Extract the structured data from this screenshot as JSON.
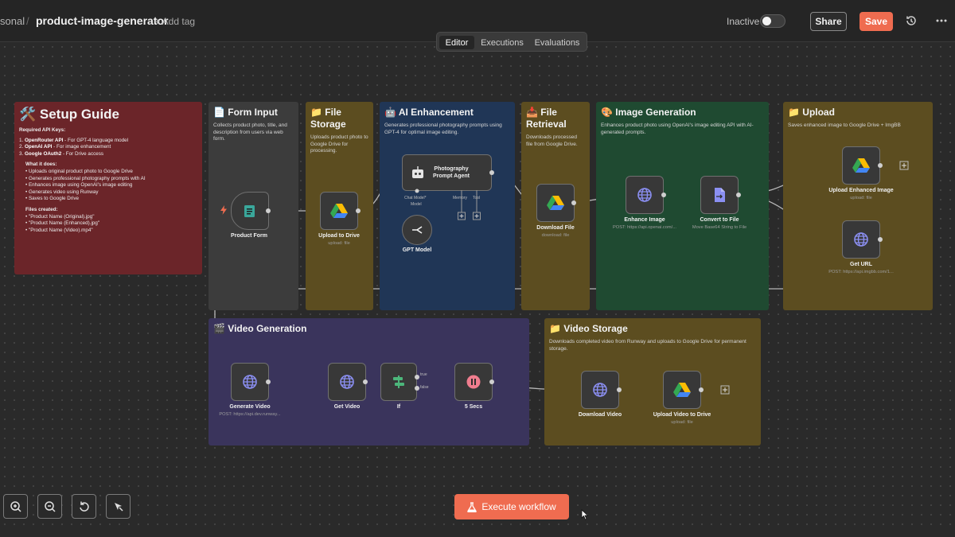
{
  "header": {
    "breadcrumb_personal": "sonal",
    "breadcrumb_sep": "/",
    "workflow_name": "product-image-generator",
    "add_tag": "+ Add tag",
    "status_label": "Inactive",
    "share_label": "Share",
    "save_label": "Save"
  },
  "tabs": [
    "Editor",
    "Executions",
    "Evaluations"
  ],
  "setup_guide": {
    "title": "🛠️ Setup Guide",
    "required_heading": "Required API Keys:",
    "api_keys": [
      {
        "name": "OpenRouter API",
        "desc": " - For GPT-4 language model"
      },
      {
        "name": "OpenAI API",
        "desc": " - For image enhancement"
      },
      {
        "name": "Google OAuth2",
        "desc": " - For Drive access"
      }
    ],
    "what_heading": "What it does:",
    "what_items": [
      "Uploads original product photo to Google Drive",
      "Generates professional photography prompts with AI",
      "Enhances image using OpenAI's image editing",
      "Generates video using Runway",
      "Saves to Google Drive"
    ],
    "files_heading": "Files created:",
    "files_items": [
      "\"Product Name (Original).jpg\"",
      "\"Product Name (Enhanced).jpg\"",
      "\"Product Name (Video).mp4\""
    ]
  },
  "stickies": {
    "form_input": {
      "title": "📄 Form Input",
      "desc": "Collects product photo, title, and description from users via web form."
    },
    "file_storage": {
      "title": "📁 File Storage",
      "desc": "Uploads product photo to Google Drive for processing."
    },
    "ai_enhancement": {
      "title": "🤖 AI Enhancement",
      "desc": "Generates professional photography prompts using GPT-4 for optimal image editing."
    },
    "file_retrieval": {
      "title": "📥 File Retrieval",
      "desc": "Downloads processed file from Google Drive."
    },
    "image_generation": {
      "title": "🎨 Image Generation",
      "desc": "Enhances product photo using OpenAI's image editing API with AI-generated prompts."
    },
    "upload": {
      "title": "📁 Upload",
      "desc": "Saves enhanced image to Google Drive + ImgBB"
    },
    "video_generation": {
      "title": "🎬 Video Generation",
      "desc": ""
    },
    "video_storage": {
      "title": "📁 Video Storage",
      "desc": "Downloads completed video from Runway and uploads to Google Drive for permanent storage."
    }
  },
  "nodes": {
    "product_form": {
      "label": "Product Form"
    },
    "upload_drive": {
      "label": "Upload to Drive",
      "sub": "upload: file"
    },
    "agent": {
      "label_line1": "Photography",
      "label_line2": "Prompt Agent",
      "port_chat": "Chat Model*",
      "port_memory": "Memory",
      "port_tool": "Tool",
      "port_model": "Model"
    },
    "gpt_model": {
      "label": "GPT Model"
    },
    "download_file": {
      "label": "Download File",
      "sub": "download: file"
    },
    "enhance_image": {
      "label": "Enhance Image",
      "sub": "POST: https://api.openai.com/..."
    },
    "convert_file": {
      "label": "Convert to File",
      "sub": "Move Base64 String to File"
    },
    "upload_enhanced": {
      "label": "Upload Enhanced Image",
      "sub": "upload: file"
    },
    "get_url": {
      "label": "Get URL",
      "sub": "POST: https://api.imgbb.com/1..."
    },
    "generate_video": {
      "label": "Generate Video",
      "sub": "POST: https://api.dev.runway..."
    },
    "get_video": {
      "label": "Get Video"
    },
    "if_node": {
      "label": "If",
      "true_label": "true",
      "false_label": "false"
    },
    "wait": {
      "label": "5 Secs"
    },
    "download_video": {
      "label": "Download Video"
    },
    "upload_video": {
      "label": "Upload Video to Drive",
      "sub": "upload: file"
    }
  },
  "footer": {
    "execute_label": "Execute workflow"
  },
  "colors": {
    "accent": "#ef6c50",
    "setup_sticky": "#6b2529",
    "gray_sticky": "#3c3c3c",
    "olive_sticky": "#5c4d20",
    "blue_sticky": "#203656",
    "green_sticky": "#1f4a31",
    "purple_sticky": "#3a345c",
    "node_bg": "#383838"
  },
  "icons": [
    "history-icon",
    "more-icon",
    "zoom-in-icon",
    "zoom-out-icon",
    "reset-icon",
    "tidy-icon",
    "flask-icon"
  ]
}
